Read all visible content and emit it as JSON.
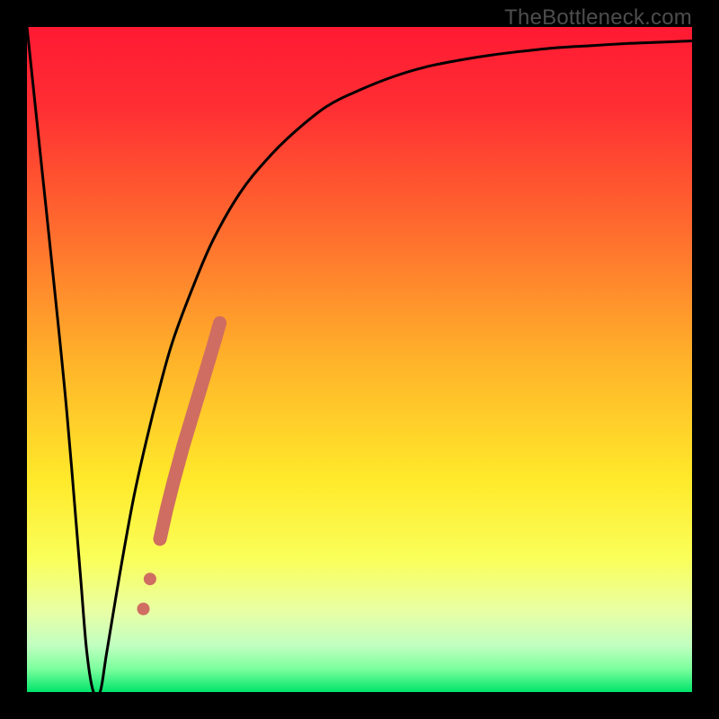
{
  "watermark": "TheBottleneck.com",
  "colors": {
    "gradient_stops": [
      {
        "offset": 0.0,
        "color": "#ff1a33"
      },
      {
        "offset": 0.12,
        "color": "#ff2e33"
      },
      {
        "offset": 0.3,
        "color": "#ff6a2e"
      },
      {
        "offset": 0.5,
        "color": "#ffb22a"
      },
      {
        "offset": 0.68,
        "color": "#ffe92a"
      },
      {
        "offset": 0.8,
        "color": "#faff5a"
      },
      {
        "offset": 0.88,
        "color": "#e8ffa6"
      },
      {
        "offset": 0.93,
        "color": "#c1ffc1"
      },
      {
        "offset": 0.965,
        "color": "#7dff9e"
      },
      {
        "offset": 1.0,
        "color": "#00e46a"
      }
    ],
    "curve": "#000000",
    "dots": "#cf6d62",
    "frame": "#000000",
    "watermark": "#4d4d4d"
  },
  "chart_data": {
    "type": "line",
    "title": "",
    "xlabel": "",
    "ylabel": "",
    "xlim": [
      0,
      100
    ],
    "ylim": [
      0,
      100
    ],
    "grid": false,
    "legend": false,
    "series": [
      {
        "name": "bottleneck-curve",
        "x": [
          0,
          2,
          4,
          6,
          8,
          9,
          10,
          11,
          12,
          14,
          16,
          18,
          20,
          22,
          25,
          28,
          32,
          36,
          40,
          45,
          50,
          55,
          60,
          65,
          70,
          75,
          80,
          85,
          90,
          95,
          100
        ],
        "y": [
          100,
          81,
          62,
          42,
          18,
          6,
          0,
          0,
          6,
          18,
          29,
          38,
          46,
          53,
          61,
          68,
          75,
          80,
          84,
          88,
          90.5,
          92.5,
          94,
          95,
          95.8,
          96.4,
          96.9,
          97.2,
          97.5,
          97.7,
          97.9
        ]
      }
    ],
    "markers": {
      "name": "highlight-dots",
      "points": [
        {
          "x": 20.0,
          "y": 23.0
        },
        {
          "x": 21.0,
          "y": 27.5
        },
        {
          "x": 22.0,
          "y": 31.5
        },
        {
          "x": 23.5,
          "y": 37.0
        },
        {
          "x": 25.0,
          "y": 42.0
        },
        {
          "x": 26.5,
          "y": 47.0
        },
        {
          "x": 28.0,
          "y": 52.0
        },
        {
          "x": 29.0,
          "y": 55.5
        }
      ],
      "extra_gap_points": [
        {
          "x": 18.5,
          "y": 17.0
        },
        {
          "x": 17.5,
          "y": 12.5
        }
      ]
    }
  }
}
